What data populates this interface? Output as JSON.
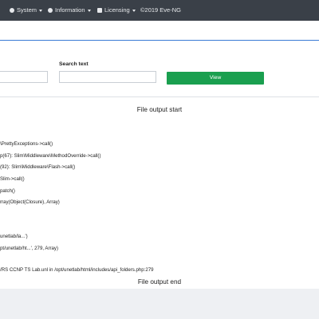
{
  "navbar": {
    "items": [
      {
        "label": "System",
        "icon": "gear-icon",
        "has_caret": true
      },
      {
        "label": "Information",
        "icon": "info-icon",
        "has_caret": true
      },
      {
        "label": "Licensing",
        "icon": "license-icon",
        "has_caret": true
      }
    ],
    "copyright": "©2019 Eve-NG"
  },
  "filters": {
    "search_text_label": "Search text",
    "first_input_value": "",
    "search_text_value": "",
    "view_button_label": "View"
  },
  "output": {
    "start_title": "File output start",
    "end_title": "File output end",
    "lines": [
      "\\PrettyExceptions->call()",
      "p(67): Slim\\Middleware\\MethodOverride->call()",
      "(92): Slim\\Middleware\\Flash->call()",
      "Slim->call()",
      "patch()",
      "rray(Object(Closure), Array)",
      "unetlab/la...')",
      "pt/unetlab/ht...', 279, Array)",
      "/RS CCNP TS Lab.unl in /opt/unetlab/html/includes/api_folders.php:279"
    ]
  },
  "colors": {
    "navbar_bg": "#3a4048",
    "header_border": "#3a7bd5",
    "view_button_bg": "#1a9f4f",
    "page_bg": "#eef0f3"
  }
}
